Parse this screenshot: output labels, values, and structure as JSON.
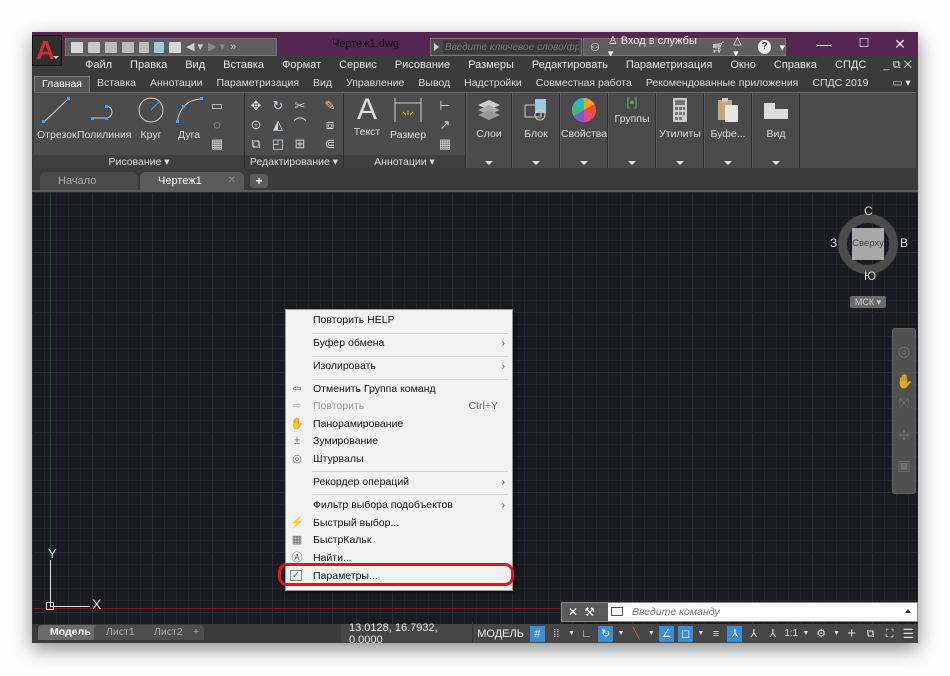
{
  "titlebar": {
    "app_logo": "A",
    "document_title": "Чертеж1.dwg",
    "search_placeholder": "Введите ключевое слово/фразу",
    "signin_label": "Вход в службы",
    "help_label": "?",
    "window_controls": {
      "minimize": "—",
      "maximize": "☐",
      "close": "✕"
    }
  },
  "quick_access": [
    "new-icon",
    "open-icon",
    "save-icon",
    "save-as-icon",
    "open-web-icon",
    "save-web-icon",
    "plot-icon",
    "undo-icon",
    "redo-icon"
  ],
  "menubar": {
    "items": [
      "Файл",
      "Правка",
      "Вид",
      "Вставка",
      "Формат",
      "Сервис",
      "Рисование",
      "Размеры",
      "Редактировать",
      "Параметризация",
      "Окно",
      "Справка",
      "СПДС"
    ],
    "mdi_controls": "_ ⧉ ✕"
  },
  "ribbon_tabs": {
    "items": [
      "Главная",
      "Вставка",
      "Аннотации",
      "Параметризация",
      "Вид",
      "Управление",
      "Вывод",
      "Надстройки",
      "Совместная работа",
      "Рекомендованные приложения",
      "СПДС 2019"
    ],
    "active": "Главная",
    "extra": "▭ ▾"
  },
  "ribbon": {
    "draw_panel": {
      "label": "Рисование ▾",
      "buttons": [
        "Отрезок",
        "Полилиния",
        "Круг",
        "Дуга"
      ]
    },
    "modify_panel": {
      "label": "Редактирование ▾"
    },
    "annotation_panel": {
      "label": "Аннотации ▾",
      "buttons": [
        "Текст",
        "Размер"
      ]
    },
    "collapsed_panels": [
      "Слои",
      "Блок",
      "Свойства",
      "Группы",
      "Утилиты",
      "Буфе...",
      "Вид"
    ]
  },
  "file_tabs": {
    "items": [
      "Начало",
      "Чертеж1"
    ],
    "active": "Чертеж1",
    "close": "✕",
    "add": "+"
  },
  "viewcube": {
    "north": "С",
    "south": "Ю",
    "west": "З",
    "east": "В",
    "face": "Сверху",
    "ucs": "МСК ▾"
  },
  "ucs_icon": {
    "x_label": "X",
    "y_label": "Y"
  },
  "context_menu": {
    "items": [
      {
        "label": "Повторить HELP",
        "icon": "",
        "submenu": false
      },
      {
        "label": "Буфер обмена",
        "icon": "",
        "submenu": true
      },
      {
        "label": "Изолировать",
        "icon": "",
        "submenu": true
      },
      {
        "label": "Отменить Группа команд",
        "icon": "undo-icon",
        "submenu": false
      },
      {
        "label": "Повторить",
        "icon": "redo-icon",
        "shortcut": "Ctrl+Y",
        "disabled": true
      },
      {
        "label": "Панорамирование",
        "icon": "pan-hand-icon"
      },
      {
        "label": "Зумирование",
        "icon": "zoom-icon"
      },
      {
        "label": "Штурвалы",
        "icon": "steering-wheel-icon"
      },
      {
        "label": "Рекордер операций",
        "icon": "",
        "submenu": true
      },
      {
        "label": "Фильтр выбора подобъектов",
        "icon": "",
        "submenu": true
      },
      {
        "label": "Быстрый выбор...",
        "icon": "quick-select-icon"
      },
      {
        "label": "БыстрКальк",
        "icon": "calculator-icon"
      },
      {
        "label": "Найти...",
        "icon": "find-icon"
      },
      {
        "label": "Параметры...",
        "icon": "options-check-icon",
        "highlighted": true
      }
    ],
    "highlight_color": "#e3141c"
  },
  "command_line": {
    "placeholder": "Введите команду"
  },
  "layout_tabs": {
    "items": [
      "Модель",
      "Лист1",
      "Лист2"
    ],
    "active": "Модель",
    "add": "+"
  },
  "statusbar": {
    "coordinates": "13.0128, 16.7932, 0.0000",
    "space": "МОДЕЛЬ",
    "annotation_scale": "1:1",
    "active_toggles": [
      "grid",
      "polar-tracking",
      "dynamic-ucs",
      "selection-cycling",
      "annotation-visibility"
    ]
  },
  "colors": {
    "titlebar": "#55264f",
    "accent_blue": "#3b8ed6",
    "canvas": "#1a1b22",
    "app_logo_red": "#d62a2a"
  }
}
